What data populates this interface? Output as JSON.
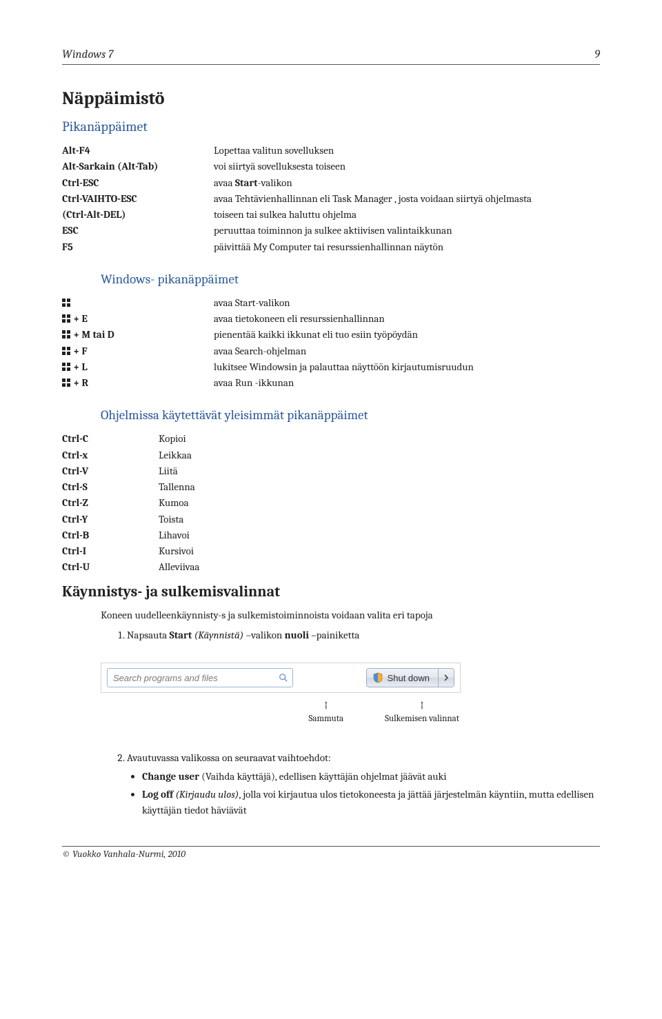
{
  "header": {
    "title": "Windows 7",
    "page_number": "9"
  },
  "section1": {
    "title": "Näppäimistö",
    "subtitle": "Pikanäppäimet",
    "rows": [
      {
        "key": "Alt-F4",
        "val": "Lopettaa valitun sovelluksen"
      },
      {
        "key": "Alt-Sarkain (Alt-Tab)",
        "val": "voi siirtyä sovelluksesta toiseen"
      },
      {
        "key": "Ctrl-ESC",
        "val_html": "avaa <strong>Start</strong>-valikon"
      },
      {
        "key": "Ctrl-VAIHTO-ESC",
        "val": "avaa Tehtävienhallinnan eli Task Manager , josta voidaan siirtyä ohjelmasta"
      },
      {
        "key": "(Ctrl-Alt-DEL)",
        "val": "toiseen tai sulkea haluttu ohjelma"
      },
      {
        "key": "ESC",
        "val": "peruuttaa toiminnon ja sulkee aktiivisen valintaikkunan"
      },
      {
        "key": "F5",
        "val": "päivittää My Computer tai resurssienhallinnan näytön"
      }
    ]
  },
  "section2": {
    "title": "Windows- pikanäppäimet",
    "rows": [
      {
        "suffix": "",
        "val": "avaa Start-valikon"
      },
      {
        "suffix": " + E",
        "val": "avaa tietokoneen eli resurssienhallinnan"
      },
      {
        "suffix": " + M tai D",
        "val": "pienentää kaikki ikkunat eli tuo esiin työpöydän"
      },
      {
        "suffix": " + F",
        "val": "avaa Search-ohjelman"
      },
      {
        "suffix": " + L",
        "val": "lukitsee Windowsin ja palauttaa näyttöön kirjautumisruudun"
      },
      {
        "suffix": " + R",
        "val": "avaa Run -ikkunan"
      }
    ]
  },
  "section3": {
    "title": "Ohjelmissa käytettävät yleisimmät pikanäppäimet",
    "rows": [
      {
        "key": "Ctrl-C",
        "val": "Kopioi"
      },
      {
        "key": "Ctrl-x",
        "val": "Leikkaa"
      },
      {
        "key": "Ctrl-V",
        "val": "Liitä"
      },
      {
        "key": "Ctrl-S",
        "val": "Tallenna"
      },
      {
        "key": "Ctrl-Z",
        "val": "Kumoa"
      },
      {
        "key": "Ctrl-Y",
        "val": "Toista"
      },
      {
        "key": "Ctrl-B",
        "val": "Lihavoi"
      },
      {
        "key": "Ctrl-I",
        "val": "Kursivoi"
      },
      {
        "key": "Ctrl-U",
        "val": "Alleviivaa"
      }
    ]
  },
  "section4": {
    "title": "Käynnistys- ja sulkemisvalinnat",
    "intro": "Koneen uudelleenkäynnisty-s ja sulkemistoiminnoista voidaan valita  eri tapoja",
    "step1_html": "Napsauta <strong>Start</strong> <em>(Käynnistä)</em>  –valikon <strong>nuoli</strong> –painiketta",
    "ui": {
      "search_placeholder": "Search programs and files",
      "shutdown_label": "Shut down"
    },
    "arrow_labels": {
      "left": "Sammuta",
      "right": "Sulkemisen valinnat"
    },
    "step2_intro": "Avautuvassa valikossa on seuraavat vaihtoehdot:",
    "bullets": [
      "<strong>Change user</strong> (Vaihda käyttäjä), edellisen käyttäjän ohjelmat jäävät auki",
      "<strong>Log off</strong> <em>(Kirjaudu ulos)</em>,  jolla voi kirjautua ulos tietokoneesta ja jättää järjestelmän käyntiin, mutta edellisen käyttäjän tiedot häviävät"
    ]
  },
  "footer": {
    "text": "© Vuokko Vanhala-Nurmi, 2010"
  }
}
